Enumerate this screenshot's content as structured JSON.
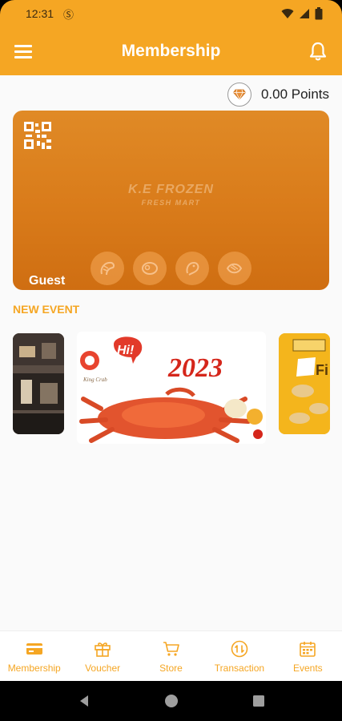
{
  "status_bar": {
    "time": "12:31",
    "sim_icon": "sim-icon",
    "icons": [
      "wifi-icon",
      "signal-icon",
      "battery-icon"
    ]
  },
  "app_bar": {
    "title": "Membership",
    "menu_icon": "menu-icon",
    "bell_icon": "bell-icon"
  },
  "points": {
    "text": "0.00 Points",
    "icon": "diamond-icon"
  },
  "card": {
    "brand_name": "K.E FROZEN",
    "brand_sub": "FRESH MART",
    "holder": "Guest",
    "qr_icon": "qr-code-icon",
    "food_icons": [
      "shrimp-icon",
      "meat-icon",
      "chicken-icon",
      "fish-icon"
    ]
  },
  "events": {
    "title": "NEW EVENT",
    "main_banner": {
      "greeting": "Hi!",
      "year": "2023",
      "caption": "King Crab"
    },
    "right_banner": {
      "text": "Fi"
    }
  },
  "bottom_nav": [
    {
      "label": "Membership",
      "icon": "card-icon"
    },
    {
      "label": "Voucher",
      "icon": "gift-icon"
    },
    {
      "label": "Store",
      "icon": "cart-icon"
    },
    {
      "label": "Transaction",
      "icon": "transaction-icon"
    },
    {
      "label": "Events",
      "icon": "calendar-icon"
    }
  ],
  "colors": {
    "accent": "#F5A623",
    "card": "#D97B1A"
  }
}
